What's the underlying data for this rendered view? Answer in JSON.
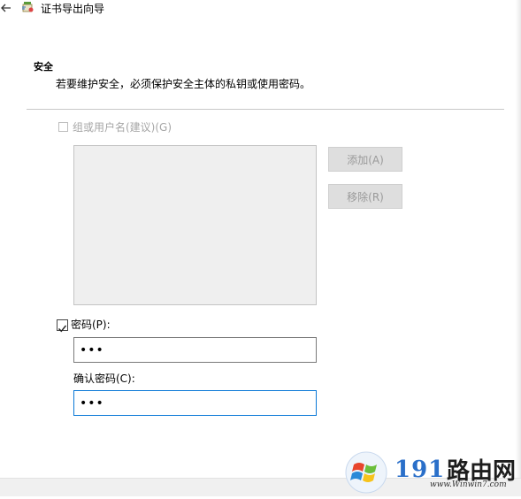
{
  "window": {
    "title": "证书导出向导",
    "back_icon": "back-arrow-icon",
    "title_icon": "certificate-icon"
  },
  "section": {
    "heading": "安全",
    "description": "若要维护安全，必须保护安全主体的私钥或使用密码。"
  },
  "group_option": {
    "label": "组或用户名(建议)(G)",
    "checked": false,
    "enabled": false
  },
  "buttons": {
    "add_label": "添加(A)",
    "remove_label": "移除(R)"
  },
  "password_option": {
    "label": "密码(P):",
    "checked": true,
    "value": "•••"
  },
  "confirm": {
    "label": "确认密码(C):",
    "value": "•••"
  },
  "watermark": {
    "number": "191",
    "site_name": "路由网",
    "url": "www.Winwin7.com"
  },
  "colors": {
    "focus_border": "#0a78d7",
    "disabled_text": "#a6a6a6",
    "list_bg": "#efefef"
  }
}
